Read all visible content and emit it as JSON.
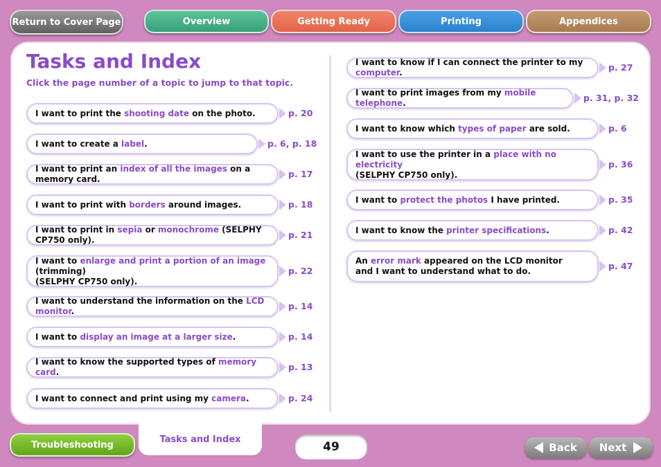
{
  "nav": {
    "cover": "Return to Cover Page",
    "tabs": [
      "Overview",
      "Getting Ready",
      "Printing",
      "Appendices"
    ],
    "colors": {
      "overview": "#3aa07a",
      "getting_ready": "#e0644a",
      "printing": "#2b82cc",
      "appendices": "#a87c52"
    }
  },
  "header": {
    "title": "Tasks and Index",
    "subtitle": "Click the page number of a topic to jump to that topic."
  },
  "left_items": [
    {
      "parts": [
        "I want to print the ",
        "shooting date",
        " on the photo."
      ],
      "pages": "p. 20"
    },
    {
      "parts": [
        "I want to create a ",
        "label",
        "."
      ],
      "pages": "p. 6, p. 18"
    },
    {
      "parts": [
        "I want to print an ",
        "index of all the images",
        " on a memory card."
      ],
      "pages": "p. 17"
    },
    {
      "parts": [
        "I want to print with ",
        "borders",
        " around images."
      ],
      "pages": "p. 18"
    },
    {
      "parts": [
        "I want to print in ",
        "sepia",
        " or ",
        "monochrome",
        " (SELPHY CP750 only)."
      ],
      "pages": "p. 21"
    },
    {
      "parts": [
        "I want to ",
        "enlarge and print a portion of an image",
        " (trimming)\n(SELPHY CP750 only)."
      ],
      "pages": "p. 22"
    },
    {
      "parts": [
        "I want to understand the information on the ",
        "LCD monitor",
        "."
      ],
      "pages": "p. 14"
    },
    {
      "parts": [
        "I want to ",
        "display an image at a larger size",
        "."
      ],
      "pages": "p. 14"
    },
    {
      "parts": [
        "I want to know the supported types of ",
        "memory card",
        "."
      ],
      "pages": "p. 13"
    },
    {
      "parts": [
        "I want to connect and print using my ",
        "camera",
        "."
      ],
      "pages": "p. 24"
    }
  ],
  "right_items": [
    {
      "parts": [
        "I want to know if I can connect the printer to my ",
        "computer",
        "."
      ],
      "pages": "p. 27"
    },
    {
      "parts": [
        "I want to print images from my ",
        "mobile telephone",
        "."
      ],
      "pages": "p. 31, p. 32"
    },
    {
      "parts": [
        "I want to know which ",
        "types of paper",
        " are sold."
      ],
      "pages": "p. 6"
    },
    {
      "parts": [
        "I want to use the printer in a ",
        "place with no electricity",
        "\n(SELPHY CP750 only)."
      ],
      "pages": "p. 36"
    },
    {
      "parts": [
        "I want to ",
        "protect the photos",
        " I have printed."
      ],
      "pages": "p. 35"
    },
    {
      "parts": [
        "I want to know the ",
        "printer specifications",
        "."
      ],
      "pages": "p. 42"
    },
    {
      "parts": [
        "An ",
        "error mark",
        " appeared on the LCD monitor\nand I want to understand what to do."
      ],
      "pages": "p. 47"
    }
  ],
  "footer": {
    "troubleshooting": "Troubleshooting",
    "current_tab": "Tasks and Index",
    "page_number": "49",
    "back": "Back",
    "next": "Next"
  }
}
